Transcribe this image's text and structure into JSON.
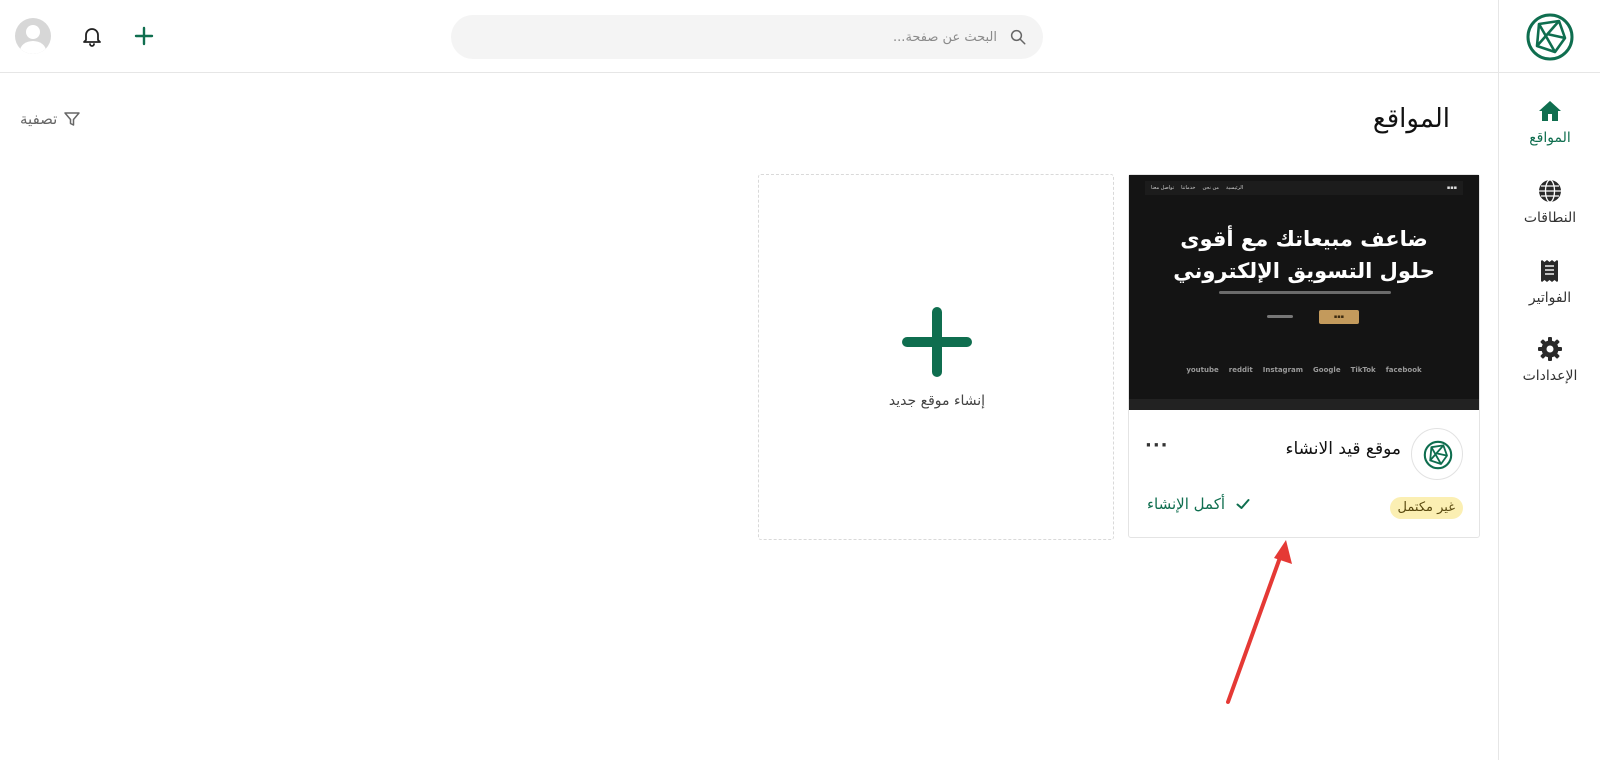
{
  "sidebar": {
    "items": [
      {
        "label": "المواقع",
        "icon": "home-icon",
        "active": true
      },
      {
        "label": "النطاقات",
        "icon": "globe-icon",
        "active": false
      },
      {
        "label": "الفواتير",
        "icon": "receipt-icon",
        "active": false
      },
      {
        "label": "الإعدادات",
        "icon": "gear-icon",
        "active": false
      }
    ]
  },
  "topbar": {
    "search_placeholder": "البحث عن صفحة...",
    "icons": [
      "avatar",
      "bell-icon",
      "plus-icon",
      "search-icon"
    ]
  },
  "page": {
    "title": "المواقع",
    "filter_label": "تصفية"
  },
  "site_card": {
    "name": "موقع قيد الانشاء",
    "more_label": "···",
    "status_badge": "غير مكتمل",
    "complete_label": "أكمل الإنشاء",
    "thumbnail": {
      "nav_links": [
        "الرئيسية",
        "من نحن",
        "خدماتنا",
        "تواصل معنا"
      ],
      "hero_line_1": "ضاعف مبيعاتك مع أقوى",
      "hero_line_2": "حلول التسويق الإلكتروني",
      "brands": [
        "youtube",
        "reddit",
        "Instagram",
        "Google",
        "TikTok",
        "facebook"
      ]
    }
  },
  "new_site_card": {
    "label": "إنشاء موقع جديد"
  },
  "colors": {
    "accent": "#0f6e4f",
    "badge_bg": "#fbefb3",
    "annotation": "#e53935"
  }
}
